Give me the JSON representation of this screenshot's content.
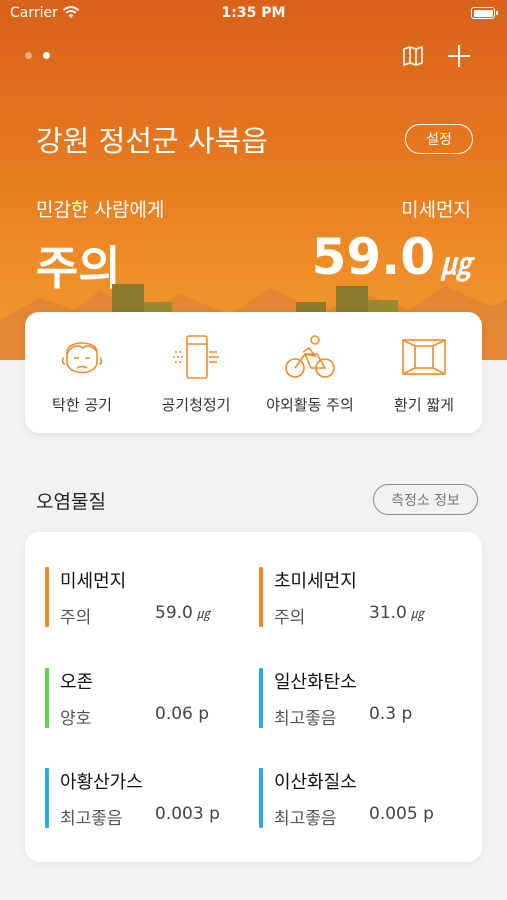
{
  "status_bar": {
    "carrier": "Carrier",
    "time": "1:35 PM"
  },
  "header": {
    "location": "강원 정선군 사북읍",
    "settings_label": "설정",
    "sensitive_label": "민감한 사람에게",
    "metric_name": "미세먼지",
    "status": "주의",
    "value": "59.0",
    "unit": "㎍"
  },
  "actions": [
    {
      "label": "탁한 공기",
      "icon": "face-icon"
    },
    {
      "label": "공기청정기",
      "icon": "air-purifier-icon"
    },
    {
      "label": "야외활동 주의",
      "icon": "cyclist-icon"
    },
    {
      "label": "환기 짧게",
      "icon": "window-icon"
    }
  ],
  "pollutants_section": {
    "title": "오염물질",
    "station_info_label": "측정소 정보",
    "items": [
      {
        "name": "미세먼지",
        "status": "주의",
        "value": "59.0",
        "unit": "㎍",
        "color": "#f08a2c"
      },
      {
        "name": "초미세먼지",
        "status": "주의",
        "value": "31.0",
        "unit": "㎍",
        "color": "#f08a2c"
      },
      {
        "name": "오존",
        "status": "양호",
        "value": "0.06 p",
        "unit": "",
        "color": "#5fd34b"
      },
      {
        "name": "일산화탄소",
        "status": "최고좋음",
        "value": "0.3 p",
        "unit": "",
        "color": "#2ea8e6"
      },
      {
        "name": "아황산가스",
        "status": "최고좋음",
        "value": "0.003 p",
        "unit": "",
        "color": "#2ea8e6"
      },
      {
        "name": "이산화질소",
        "status": "최고좋음",
        "value": "0.005 p",
        "unit": "",
        "color": "#2ea8e6"
      }
    ]
  },
  "colors": {
    "hero_top": "#d9611a",
    "hero_bottom": "#f19a2e",
    "accent_orange": "#f08a2c",
    "good_green": "#5fd34b",
    "best_blue": "#2ea8e6",
    "icon_orange": "#f08a2c"
  }
}
